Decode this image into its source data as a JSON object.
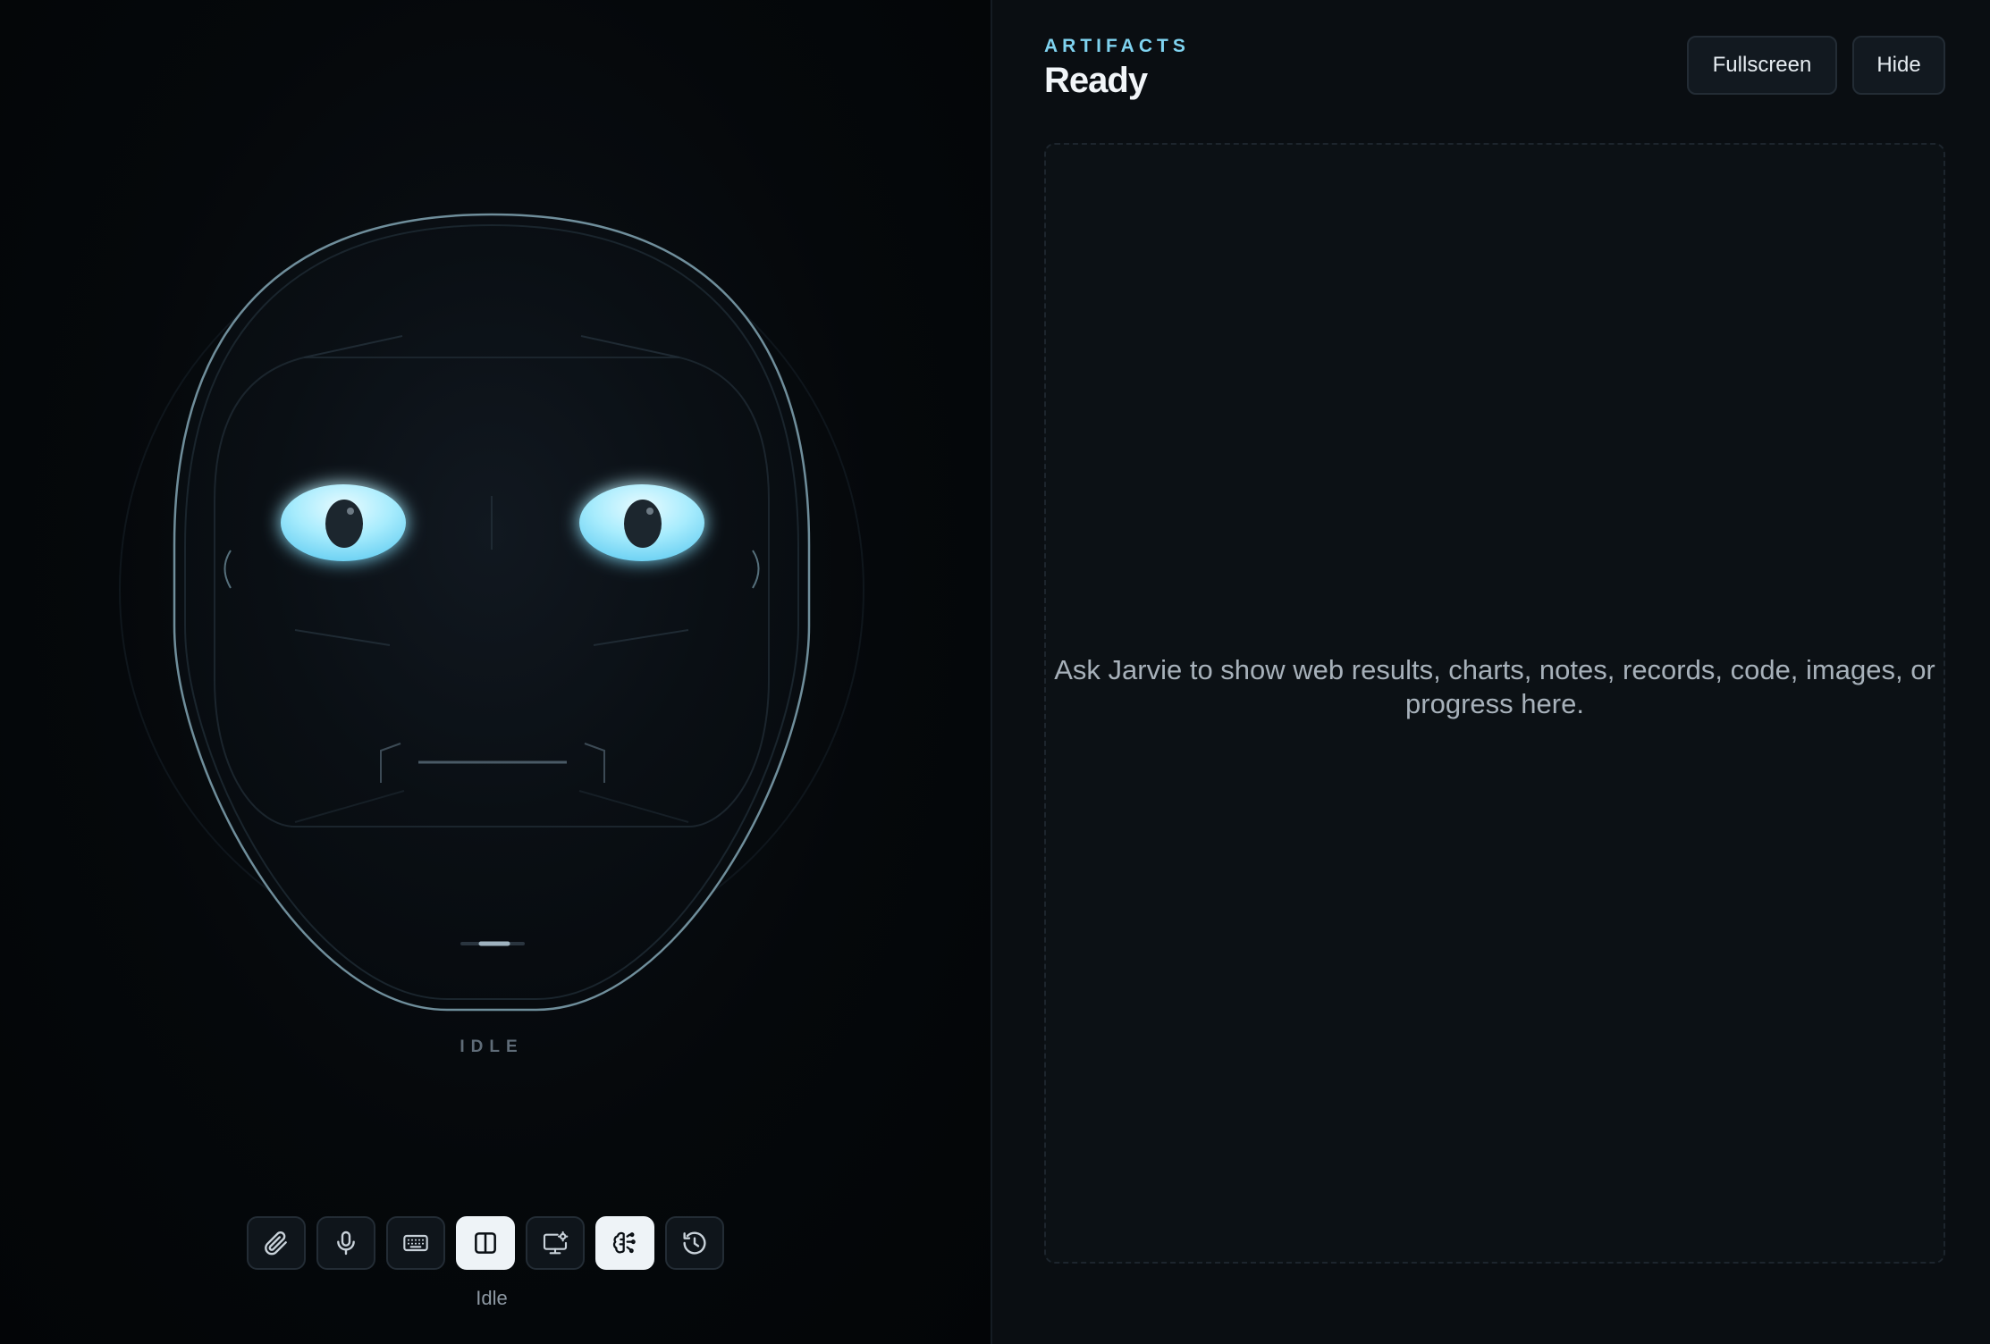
{
  "face": {
    "state": "IDLE",
    "colors": {
      "shell_stroke": "#6f8e9b",
      "eye_glow": "#8fe3fb",
      "pupil": "#1e262d",
      "mouth": "#4a5a66"
    }
  },
  "toolbar": {
    "buttons": [
      {
        "name": "attach",
        "icon": "paperclip-icon",
        "active": false
      },
      {
        "name": "microphone",
        "icon": "microphone-icon",
        "active": false
      },
      {
        "name": "keyboard",
        "icon": "keyboard-icon",
        "active": false
      },
      {
        "name": "panel",
        "icon": "panel-split-icon",
        "active": true
      },
      {
        "name": "screen-share",
        "icon": "monitor-settings-icon",
        "active": false
      },
      {
        "name": "brain",
        "icon": "brain-icon",
        "active": true
      },
      {
        "name": "history",
        "icon": "history-icon",
        "active": false
      }
    ],
    "status": "Idle"
  },
  "artifacts": {
    "eyebrow": "ARTIFACTS",
    "title": "Ready",
    "fullscreen_label": "Fullscreen",
    "hide_label": "Hide",
    "hint": "Ask Jarvie to show web results, charts, notes, records, code, images, or progress here.",
    "accent": "#7fd3f0"
  }
}
